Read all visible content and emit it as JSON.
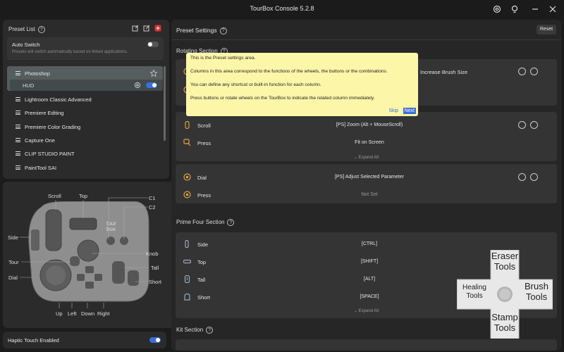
{
  "window": {
    "title": "TourBox Console 5.2.8"
  },
  "left": {
    "preset_list_title": "Preset List",
    "auto_switch": {
      "label": "Auto Switch",
      "desc": "Presets will switch automatically based on linked applications.",
      "on": false
    },
    "presets": [
      {
        "label": "Photoshop",
        "selected": true
      },
      {
        "label": "HUD",
        "sub": true
      },
      {
        "label": "Lightroom Classic Advanced"
      },
      {
        "label": "Premiere Editing"
      },
      {
        "label": "Premiere Color Grading"
      },
      {
        "label": "Capture One"
      },
      {
        "label": "CLIP STUDIO PAINT"
      },
      {
        "label": "PaintTool SAI"
      }
    ],
    "device_labels": {
      "scroll": "Scroll",
      "top": "Top",
      "c1": "C1",
      "c2": "C2",
      "side": "Side",
      "knob": "Knob",
      "tour": "Tour",
      "tall": "Tall",
      "dial": "Dial",
      "short": "Short",
      "up": "Up",
      "left": "Left",
      "down": "Down",
      "right": "Right"
    },
    "device_logo": "tour box",
    "haptic": {
      "label": "Haptic Touch Enabled",
      "on": true
    }
  },
  "right": {
    "title": "Preset Settings",
    "reset_label": "Reset",
    "rotating_section": "Rotating Section",
    "prime_four_section": "Prime Four Section",
    "kit_section": "Kit Section",
    "knob_value": "Increase Brush Size",
    "expand_label": "Expand All",
    "scroll_card": [
      {
        "name": "Scroll",
        "value": "[PS] Zoom (Alt + MouseScroll)"
      },
      {
        "name": "Press",
        "value": "Fit on Screen"
      }
    ],
    "dial_card": [
      {
        "name": "Dial",
        "value": "[PS] Adjust Selected Parameter"
      },
      {
        "name": "Press",
        "value": "Not Set"
      }
    ],
    "prime_card": [
      {
        "name": "Side",
        "value": "[CTRL]"
      },
      {
        "name": "Top",
        "value": "[SHIFT]"
      },
      {
        "name": "Tall",
        "value": "[ALT]"
      },
      {
        "name": "Short",
        "value": "[SPACE]"
      }
    ]
  },
  "tooltip": {
    "lines": [
      "This is the Preset settings area.",
      "Columns in this area correspond to the functions of the wheels, the buttons or the combinations.",
      "You can define any shortcut or built-in function for each column.",
      "Press buttons or rotate wheels on the TourBox to indicate the related column immediately."
    ],
    "skip": "Skip",
    "next": "Next"
  },
  "overlay": {
    "top": "Eraser\nTools",
    "left": "Healing\nTools",
    "right": "Brush\nTools",
    "bottom": "Stamp\nTools"
  },
  "colors": {
    "accent": "#3a6fd8",
    "icon_orange": "#e0a040",
    "tooltip_bg": "#fcf6a8"
  }
}
